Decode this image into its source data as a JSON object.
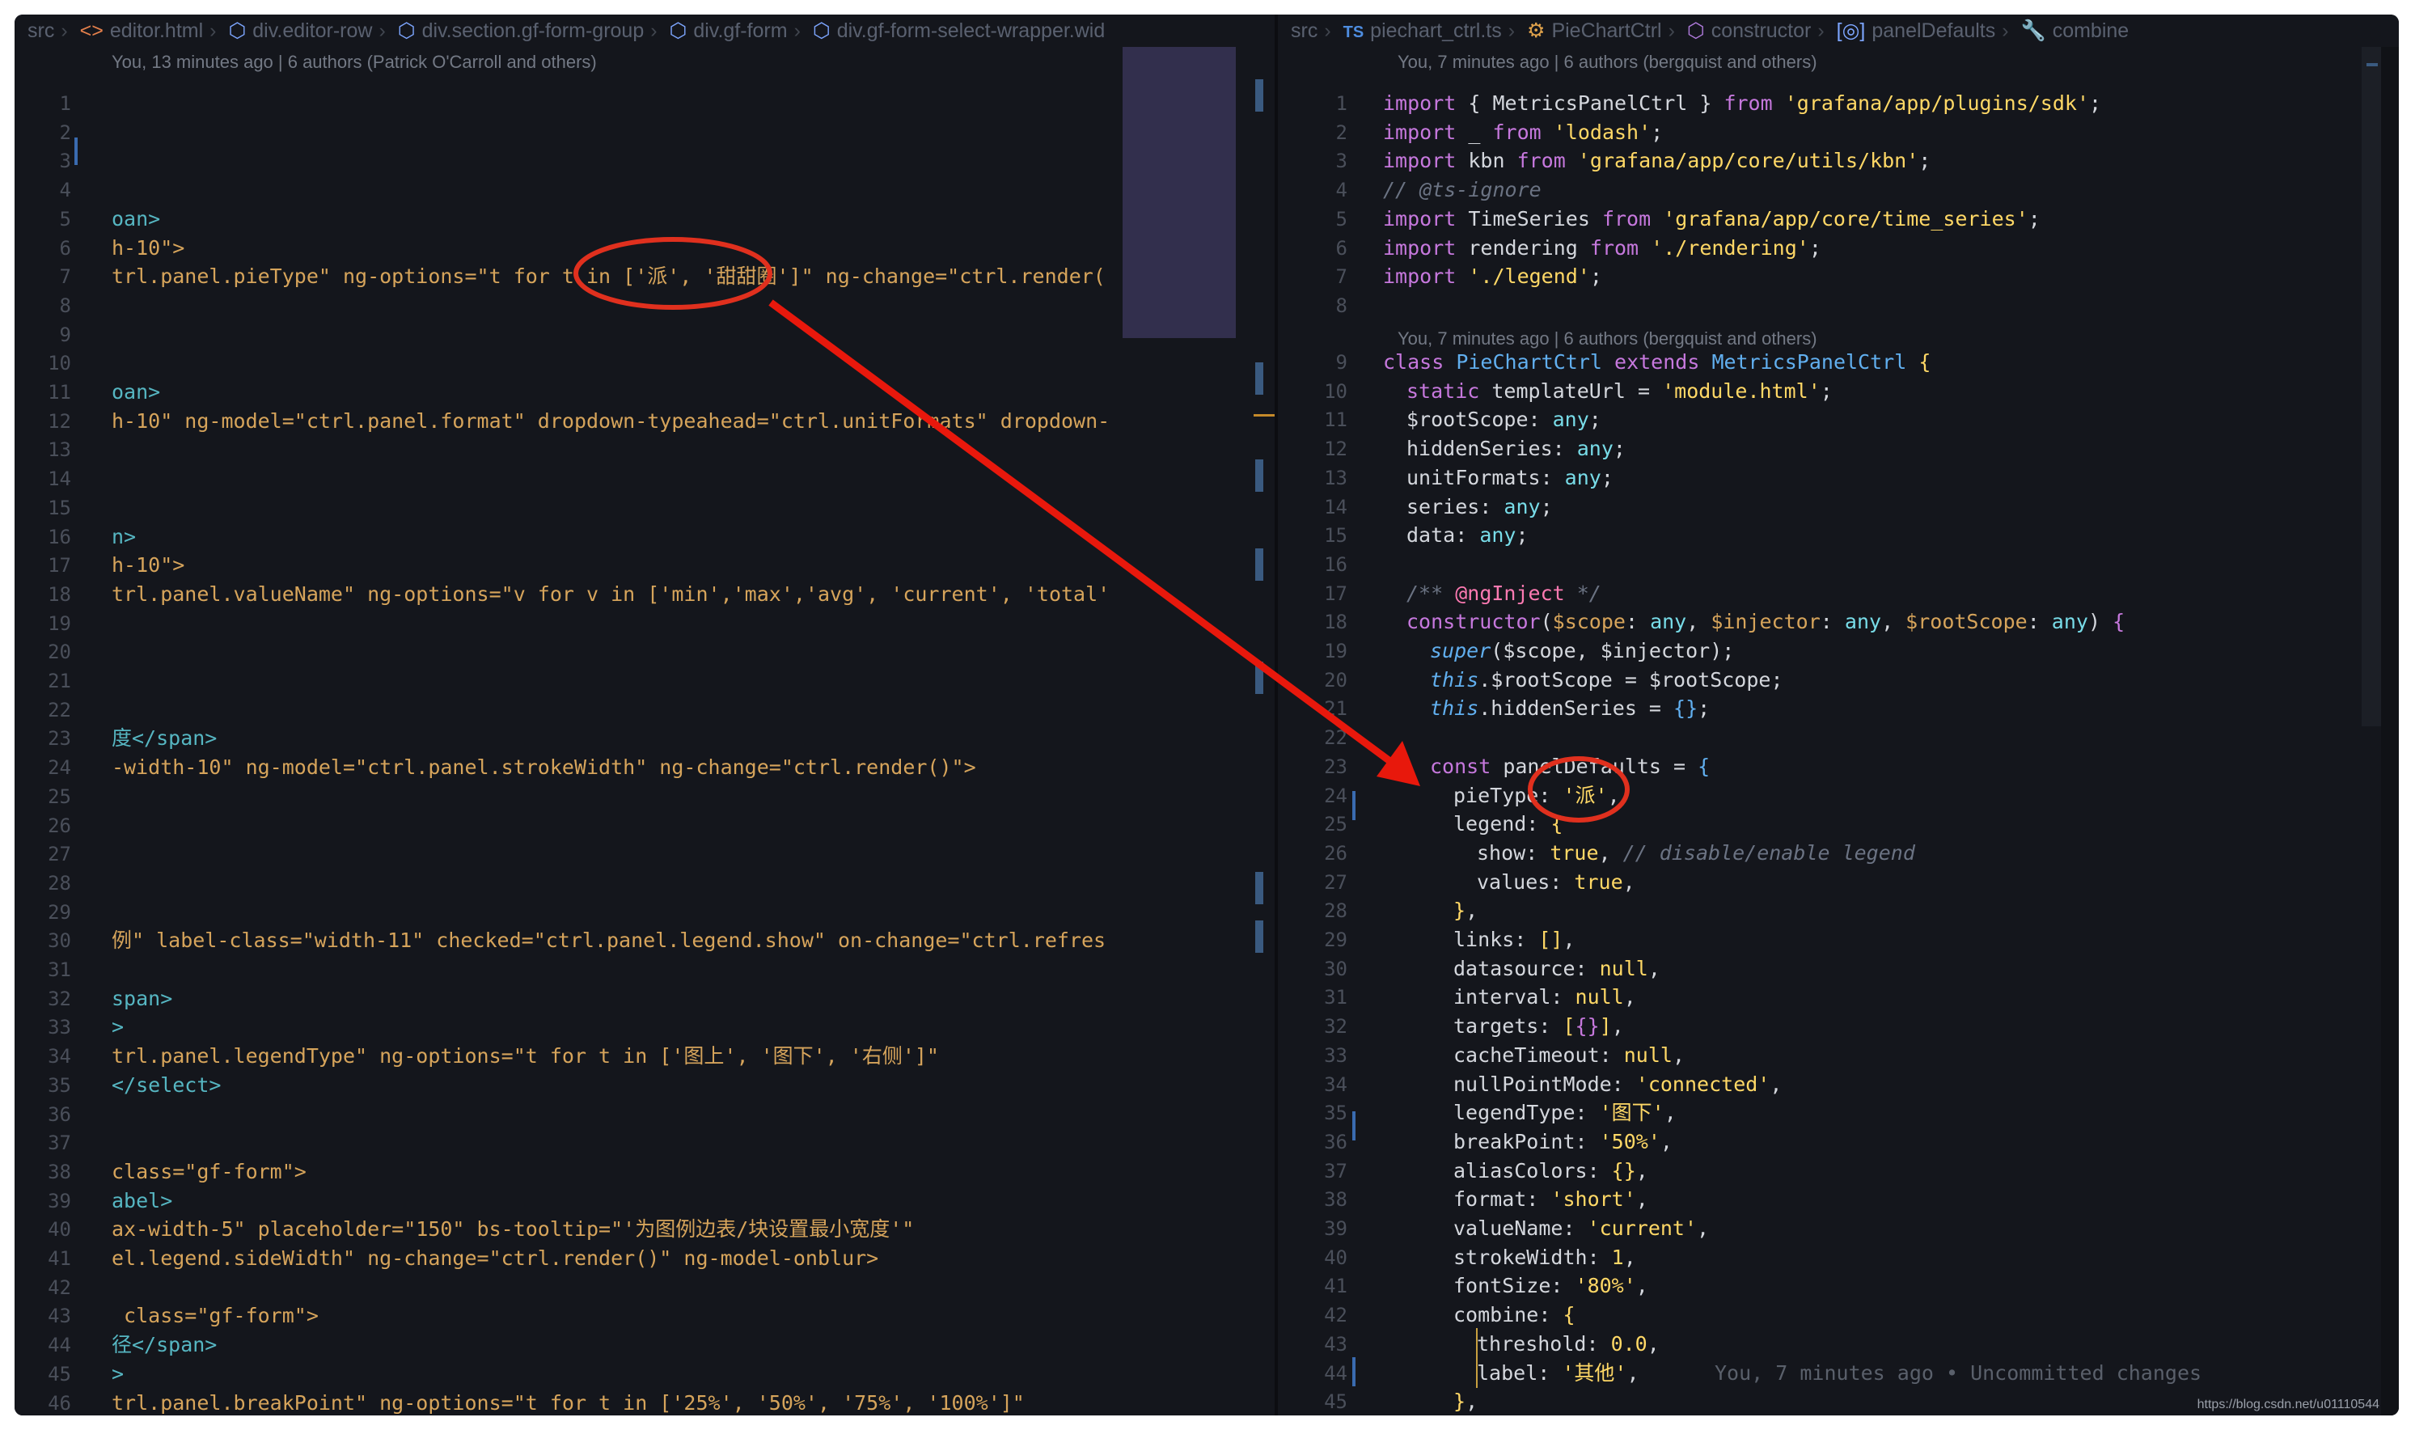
{
  "left": {
    "breadcrumb": [
      {
        "label": "src",
        "icon": ""
      },
      {
        "label": "editor.html",
        "icon": "<>"
      },
      {
        "label": "div.editor-row",
        "icon": "cube"
      },
      {
        "label": "div.section.gf-form-group",
        "icon": "cube"
      },
      {
        "label": "div.gf-form",
        "icon": "cube"
      },
      {
        "label": "div.gf-form-select-wrapper.wid",
        "icon": "cube"
      }
    ],
    "blame": "You, 13 minutes ago | 6 authors (Patrick O'Carroll and others)",
    "line_numbers": [
      "1",
      "2",
      "3",
      "4",
      "5",
      "6",
      "7",
      "8",
      "9",
      "10",
      "11",
      "12",
      "13",
      "14",
      "15",
      "16",
      "17",
      "18",
      "19",
      "20",
      "21",
      "22",
      "23",
      "24",
      "25",
      "26",
      "27",
      "28",
      "29",
      "30",
      "31",
      "32",
      "33",
      "34",
      "35",
      "36",
      "37",
      "38",
      "39",
      "40",
      "41",
      "42",
      "43",
      "44",
      "45",
      "46"
    ],
    "lines": {
      "l5": "oan>",
      "l6": "h-10\">",
      "l7a": "trl.panel.pieType\" ng-options=\"t for t in ['派', '甜甜圈']\" ng-change=\"ctrl.render()\">",
      "l11": "oan>",
      "l12": "h-10\" ng-model=\"ctrl.panel.format\" dropdown-typeahead=\"ctrl.unitFormats\" dropdown-typ",
      "l16": "n>",
      "l17": "h-10\">",
      "l18": "trl.panel.valueName\" ng-options=\"v for v in ['min','max','avg', 'current', 'total']\"",
      "l23": "度</span>",
      "l24": "-width-10\" ng-model=\"ctrl.panel.strokeWidth\" ng-change=\"ctrl.render()\">",
      "l30": "例\" label-class=\"width-11\" checked=\"ctrl.panel.legend.show\" on-change=\"ctrl.refresh()\"",
      "l32": "span>",
      "l33": ">",
      "l34": "trl.panel.legendType\" ng-options=\"t for t in ['图上', '图下', '右侧']\"",
      "l35": "</select>",
      "l38": "class=\"gf-form\">",
      "l39": "abel>",
      "l40": "ax-width-5\" placeholder=\"150\" bs-tooltip=\"'为图例边表/块设置最小宽度'\"",
      "l41": "el.legend.sideWidth\" ng-change=\"ctrl.render()\" ng-model-onblur>",
      "l43": " class=\"gf-form\">",
      "l44": "径</span>",
      "l45": ">",
      "l46": "trl.panel.breakPoint\" ng-options=\"t for t in ['25%', '50%', '75%', '100%']\""
    }
  },
  "right": {
    "breadcrumb": [
      {
        "label": "src",
        "icon": ""
      },
      {
        "label": "piechart_ctrl.ts",
        "icon": "TS"
      },
      {
        "label": "PieChartCtrl",
        "icon": "class"
      },
      {
        "label": "constructor",
        "icon": "cube"
      },
      {
        "label": "panelDefaults",
        "icon": "var"
      },
      {
        "label": "combine",
        "icon": "wrench"
      }
    ],
    "blame_top": "You, 7 minutes ago | 6 authors (bergquist and others)",
    "blame_mid": "You, 7 minutes ago | 6 authors (bergquist and others)",
    "inline_blame": "You, 7 minutes ago • Uncommitted changes",
    "line_numbers": [
      "1",
      "2",
      "3",
      "4",
      "5",
      "6",
      "7",
      "8",
      "9",
      "10",
      "11",
      "12",
      "13",
      "14",
      "15",
      "16",
      "17",
      "18",
      "19",
      "20",
      "21",
      "22",
      "23",
      "24",
      "25",
      "26",
      "27",
      "28",
      "29",
      "30",
      "31",
      "32",
      "33",
      "34",
      "35",
      "36",
      "37",
      "38",
      "39",
      "40",
      "41",
      "42",
      "43",
      "44",
      "45"
    ],
    "code": {
      "r1_mod": "{ MetricsPanelCtrl }",
      "r1_from": "'grafana/app/plugins/sdk'",
      "r2_from": "'lodash'",
      "r3_from": "'grafana/app/core/utils/kbn'",
      "r4": "// @ts-ignore",
      "r5_from": "'grafana/app/core/time_series'",
      "r6_from": "'./rendering'",
      "r7_from": "'./legend'",
      "r10_val": "'module.html'",
      "r24_val": "'派'",
      "r34_val": "'connected'",
      "r35_val": "'图下'",
      "r36_val": "'50%'",
      "r38_val": "'short'",
      "r39_val": "'current'",
      "r41_val": "'80%'",
      "r43_val": "0.0",
      "r44_val": "'其他'"
    }
  },
  "annotation": {
    "color": "#e0301e",
    "arrow_color": "#e8180c"
  },
  "watermark": "https://blog.csdn.net/u01110544"
}
